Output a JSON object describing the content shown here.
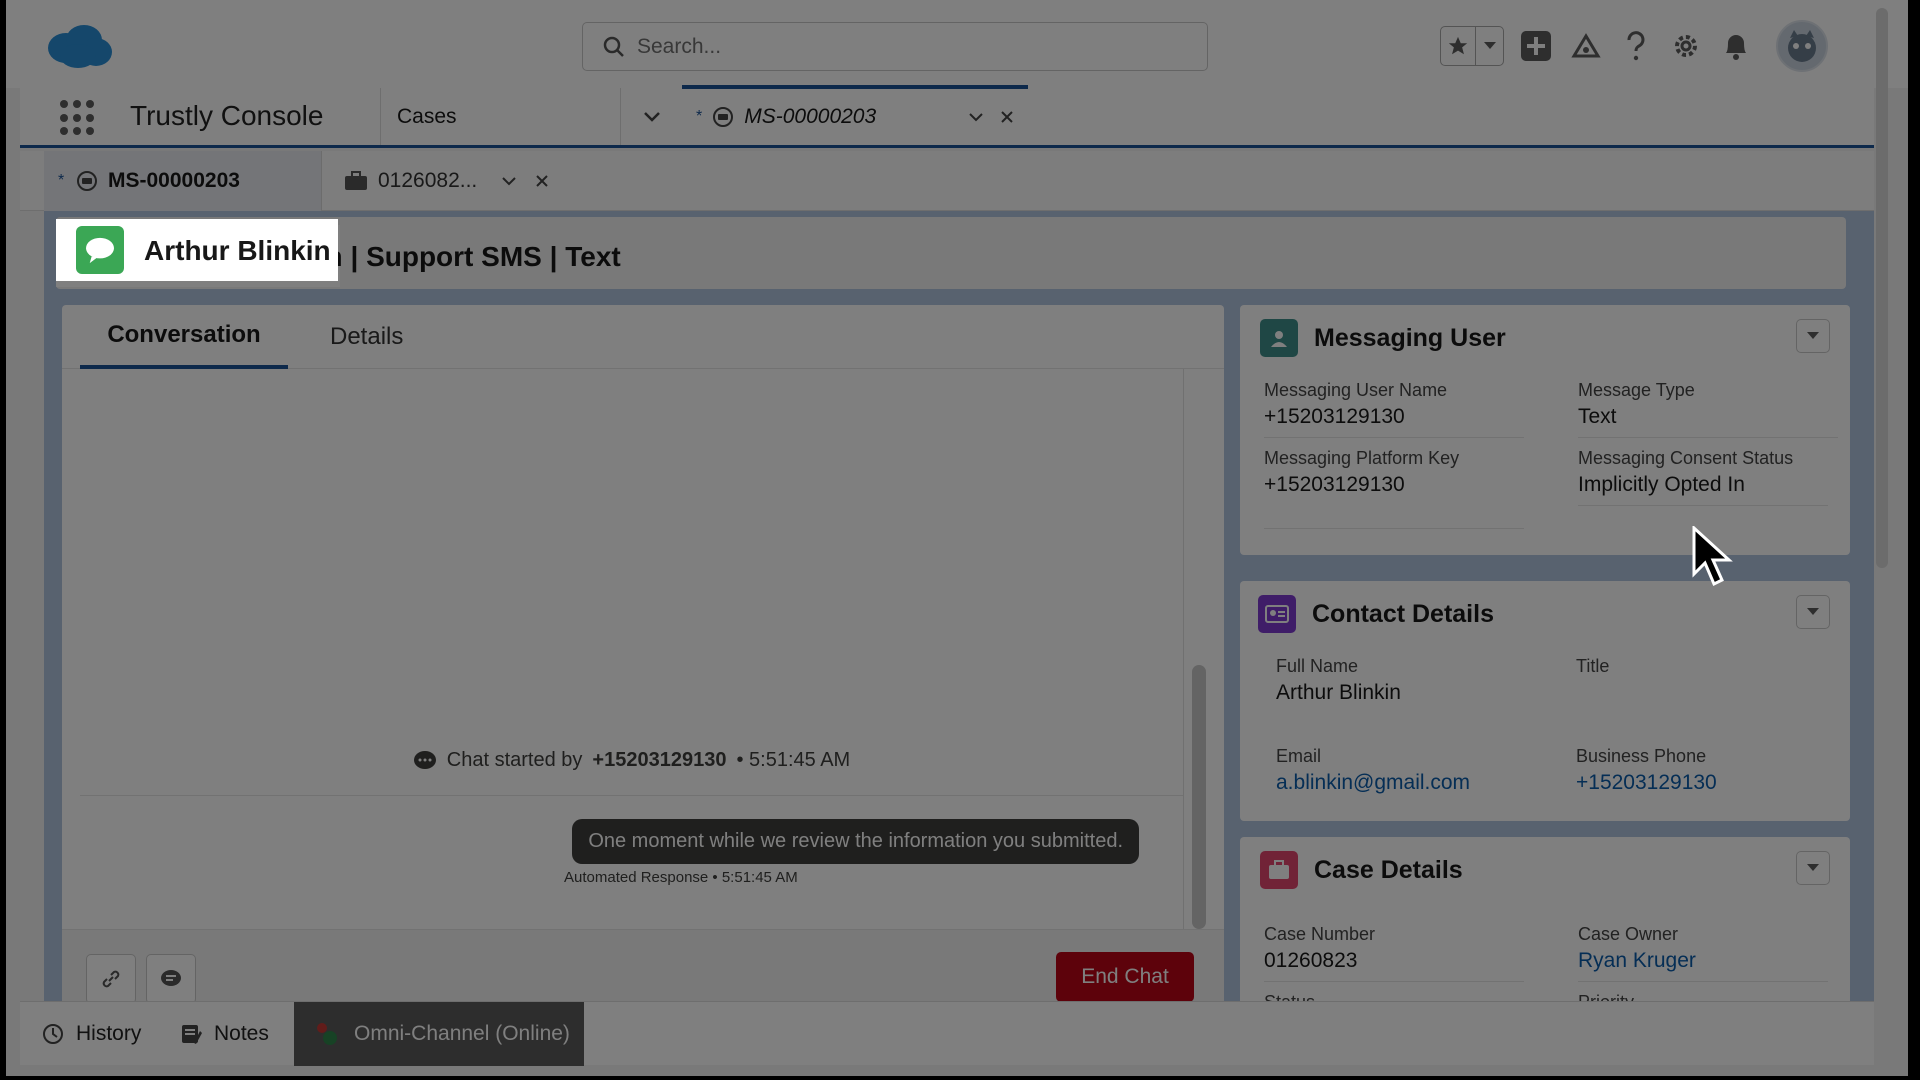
{
  "header": {
    "search_placeholder": "Search...",
    "icons": [
      "salesforce-cloud-icon",
      "search-icon",
      "star-icon",
      "chevron-down-icon",
      "add-icon",
      "trailhead-icon",
      "help-icon",
      "gear-icon",
      "bell-icon",
      "avatar"
    ]
  },
  "nav": {
    "app_name": "Trustly Console",
    "cases_label": "Cases",
    "active_tab_label": "MS-00000203",
    "active_tab_marker": "*"
  },
  "subtabs": {
    "tab1_label": "MS-00000203",
    "tab1_marker": "*",
    "tab2_label": "0126082..."
  },
  "record": {
    "title_name": "Arthur Blinkin",
    "title_rest": " | Support SMS | Text",
    "icon_label": "SMS"
  },
  "conversation": {
    "tabs": [
      "Conversation",
      "Details"
    ],
    "chat_started_prefix": "Chat started by",
    "chat_started_by": "+15203129130",
    "chat_started_time": "• 5:51:45 AM",
    "bot_message": "One moment while we review the information you submitted.",
    "bot_meta": "Automated Response • 5:51:45 AM",
    "end_chat_label": "End Chat"
  },
  "messaging_user": {
    "title": "Messaging User",
    "fields": [
      {
        "label": "Messaging User Name",
        "value": "+15203129130"
      },
      {
        "label": "Message Type",
        "value": "Text"
      },
      {
        "label": "Messaging Platform Key",
        "value": "+15203129130"
      },
      {
        "label": "Messaging Consent Status",
        "value": "Implicitly Opted In"
      }
    ]
  },
  "contact_details": {
    "title": "Contact Details",
    "fields": [
      {
        "label": "Full Name",
        "value": "Arthur Blinkin"
      },
      {
        "label": "Title",
        "value": ""
      },
      {
        "label": "Email",
        "value": "a.blinkin@gmail.com"
      },
      {
        "label": "Business Phone",
        "value": "+15203129130"
      }
    ]
  },
  "case_details": {
    "title": "Case Details",
    "fields": [
      {
        "label": "Case Number",
        "value": "01260823"
      },
      {
        "label": "Case Owner",
        "value": "Ryan Kruger"
      },
      {
        "label": "Status",
        "value": ""
      },
      {
        "label": "Priority",
        "value": ""
      }
    ]
  },
  "utility_bar": {
    "history_label": "History",
    "notes_label": "Notes",
    "omni_label": "Omni-Channel (Online)"
  },
  "colors": {
    "brand_blue": "#1b5297",
    "sms_green": "#3ba755",
    "end_chat_red": "#ba0517",
    "link_blue": "#0b5cab",
    "contact_purple": "#7f3bd1",
    "case_pink": "#e3466f",
    "messaging_teal": "#3f8f8a"
  }
}
